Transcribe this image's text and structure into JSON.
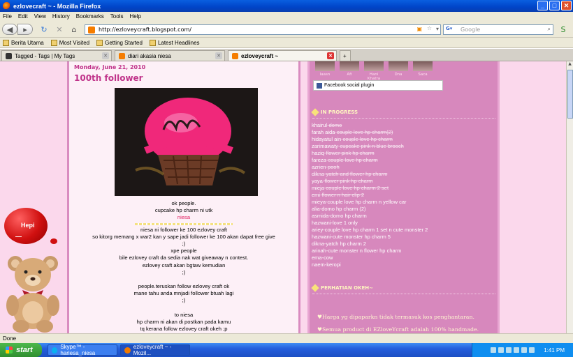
{
  "window": {
    "title": "ezlovecraft ~ - Mozilla Firefox"
  },
  "menu": [
    "File",
    "Edit",
    "View",
    "History",
    "Bookmarks",
    "Tools",
    "Help"
  ],
  "nav": {
    "url": "http://ezloveycraft.blogspot.com/",
    "search_placeholder": "Google"
  },
  "bookmarks": [
    "Berita Utama",
    "Most Visited",
    "Getting Started",
    "Latest Headlines"
  ],
  "tabs": [
    {
      "label": "Tagged - Tags | My Tags"
    },
    {
      "label": "diari akasia niesa"
    },
    {
      "label": "ezloveycraft ~"
    }
  ],
  "left": {
    "bubble_text": "Hepi",
    "bubble_sub": "—"
  },
  "post": {
    "date": "Monday, June 21, 2010",
    "title": "100th follower",
    "lines": [
      {
        "text": "ok people.",
        "cls": ""
      },
      {
        "text": "cupcake hp charm ni utk",
        "cls": ""
      },
      {
        "text": "niesa",
        "cls": "red"
      },
      {
        "text": "",
        "cls": "div"
      },
      {
        "text": "niesa ni follower ke 100 ezlovey craft",
        "cls": ""
      },
      {
        "text": "so kitorg memang x war2 kan y sape jadi follower ke 100 akan dapat free give",
        "cls": ""
      },
      {
        "text": ";)",
        "cls": ""
      },
      {
        "text": "xpe people",
        "cls": ""
      },
      {
        "text": "bile ezlovey craft da sedia nak wat giveaway n contest.",
        "cls": ""
      },
      {
        "text": "ezlovey craft akan bgtaw kemudian",
        "cls": ""
      },
      {
        "text": ";)",
        "cls": ""
      },
      {
        "text": "",
        "cls": "blank"
      },
      {
        "text": "people.teruskan follow ezlovey craft ok",
        "cls": ""
      },
      {
        "text": "mane tahu anda mnjadi follower btuah lagi",
        "cls": ""
      },
      {
        "text": ";)",
        "cls": ""
      },
      {
        "text": "",
        "cls": "blank"
      },
      {
        "text": "to niesa",
        "cls": ""
      },
      {
        "text": "hp charm ni akan di postkan pada kamu",
        "cls": ""
      },
      {
        "text": "tq kerana follow ezlovey craft okeh ;p",
        "cls": ""
      }
    ]
  },
  "sidebar": {
    "avatar_names": [
      "Iaasn",
      "Afi",
      "Hani Khatra",
      "Dna",
      "Saca"
    ],
    "fb_plugin": "Facebook social plugin",
    "in_progress_heading": "IN PROGRESS",
    "orders": [
      {
        "name": "khairul-",
        "item": "domo",
        "done": true
      },
      {
        "name": "farah aida-",
        "item": "couple love hp charm(2)",
        "done": true
      },
      {
        "name": "hidayatul ain-",
        "item": "couple love hp charm",
        "done": true
      },
      {
        "name": "zarimawaty-",
        "item": "cupcake pink n blue brooch",
        "done": true
      },
      {
        "name": "haziq-",
        "item": "flower pink hp charm",
        "done": true
      },
      {
        "name": "fareza-",
        "item": "couple love hp charm",
        "done": true
      },
      {
        "name": "azrien-",
        "item": "pooh",
        "done": true
      },
      {
        "name": "dikna-",
        "item": "yatch and flower hp charm",
        "done": true
      },
      {
        "name": "yaya-",
        "item": "flower pink hp charm",
        "done": true
      },
      {
        "name": "mieja-",
        "item": "couple love hp charm 2 set",
        "done": true
      },
      {
        "name": "emi-",
        "item": "flower n hair clip 2",
        "done": true
      },
      {
        "name": "mieya-",
        "item": "couple love hp charm n yellow car",
        "done": false
      },
      {
        "name": "alia-",
        "item": "domo hp charm (2)",
        "done": false
      },
      {
        "name": "asmida-",
        "item": "domo hp charm",
        "done": false
      },
      {
        "name": "hazwani-",
        "item": "love 1 only",
        "done": false
      },
      {
        "name": "ariey-",
        "item": "couple love hp charm 1 set n cute monster 2",
        "done": false
      },
      {
        "name": "hazwani-",
        "item": "cute monster hp charm 5",
        "done": false
      },
      {
        "name": "dikna-",
        "item": "yatch hp charm 2",
        "done": false
      },
      {
        "name": "arinah-",
        "item": "cute monster n flower hp charm",
        "done": false
      },
      {
        "name": "ema-",
        "item": "cow",
        "done": false
      },
      {
        "name": "naem-",
        "item": "keropi",
        "done": false
      }
    ],
    "perhatian_heading": "PERHATIAN OKEH~",
    "notes": [
      "♥Harga yg dipaparkn tidak termasuk kos penghantaran.",
      "♥Semua product di EZloveYcraft adalah 100% handmade."
    ]
  },
  "status": {
    "text": "Done"
  },
  "taskbar": {
    "start": "start",
    "buttons": [
      "Skype™ - hariesa_niesa",
      "ezloveycraft ~ - Mozil..."
    ],
    "clock": "1:41 PM"
  }
}
